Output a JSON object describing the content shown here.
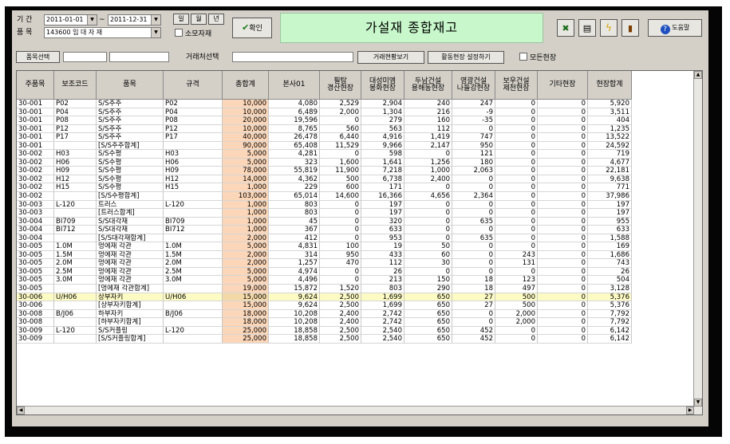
{
  "filters": {
    "period_label": "기 간",
    "date_from": "2011-01-01",
    "tilde": "~",
    "date_to": "2011-12-31",
    "period_buttons": [
      "일",
      "월",
      "년"
    ],
    "category_label": "품 목",
    "category_value": "143600 임 대 자 재",
    "consumable_check_label": "소모자재",
    "confirm_label": "확인",
    "item_select_label": "품목선택",
    "client_select_label": "거래처선택",
    "client_status_button": "거래현황보기",
    "active_site_button": "활동현장 설정하기",
    "all_sites_check_label": "모든현장"
  },
  "title": "가설재 종합재고",
  "help_label": "도움말",
  "icons": [
    "excel-icon",
    "print-icon",
    "lightning-icon",
    "exit-icon",
    "help-icon"
  ],
  "colors": {
    "total_column": "#fbd6b8",
    "selected_row": "#fdfbc4",
    "title_bg": "#c7f7ca"
  },
  "table": {
    "columns": [
      "주품목",
      "보조코드",
      "품목",
      "규격",
      "총합계",
      "본사01",
      "필탐\n경산현장",
      "대성미엠\n봉화현장",
      "두남건설\n용해동현장",
      "영광건설\n나들강현장",
      "보우건설\n제천현장",
      "기타현장",
      "현장합계"
    ],
    "selected_row_index": 41,
    "rows": [
      [
        "30-001",
        "P02",
        "S/S주주",
        "P02",
        "10,000",
        "4,080",
        "2,529",
        "2,904",
        "240",
        "247",
        "0",
        "0",
        "5,920"
      ],
      [
        "30-001",
        "P04",
        "S/S주주",
        "P04",
        "10,000",
        "6,489",
        "2,000",
        "1,304",
        "216",
        "-9",
        "0",
        "0",
        "3,511"
      ],
      [
        "30-001",
        "P08",
        "S/S주주",
        "P08",
        "20,000",
        "19,596",
        "0",
        "279",
        "160",
        "-35",
        "0",
        "0",
        "404"
      ],
      [
        "30-001",
        "P12",
        "S/S주주",
        "P12",
        "10,000",
        "8,765",
        "560",
        "563",
        "112",
        "0",
        "0",
        "0",
        "1,235"
      ],
      [
        "30-001",
        "P17",
        "S/S주주",
        "P17",
        "40,000",
        "26,478",
        "6,440",
        "4,916",
        "1,419",
        "747",
        "0",
        "0",
        "13,522"
      ],
      [
        "30-001",
        "",
        "[S/S주주합계]",
        "",
        "90,000",
        "65,408",
        "11,529",
        "9,966",
        "2,147",
        "950",
        "0",
        "0",
        "24,592"
      ],
      [
        "30-002",
        "H03",
        "S/S수평",
        "H03",
        "5,000",
        "4,281",
        "0",
        "598",
        "0",
        "121",
        "0",
        "0",
        "719"
      ],
      [
        "30-002",
        "H06",
        "S/S수평",
        "H06",
        "5,000",
        "323",
        "1,600",
        "1,641",
        "1,256",
        "180",
        "0",
        "0",
        "4,677"
      ],
      [
        "30-002",
        "H09",
        "S/S수평",
        "H09",
        "78,000",
        "55,819",
        "11,900",
        "7,218",
        "1,000",
        "2,063",
        "0",
        "0",
        "22,181"
      ],
      [
        "30-002",
        "H12",
        "S/S수평",
        "H12",
        "14,000",
        "4,362",
        "500",
        "6,738",
        "2,400",
        "0",
        "0",
        "0",
        "9,638"
      ],
      [
        "30-002",
        "H15",
        "S/S수평",
        "H15",
        "1,000",
        "229",
        "600",
        "171",
        "0",
        "0",
        "0",
        "0",
        "771"
      ],
      [
        "30-002",
        "",
        "[S/S수평합계]",
        "",
        "103,000",
        "65,014",
        "14,600",
        "16,366",
        "4,656",
        "2,364",
        "0",
        "0",
        "37,986"
      ],
      [
        "30-003",
        "L-120",
        "트러스",
        "L-120",
        "1,000",
        "803",
        "0",
        "197",
        "0",
        "0",
        "0",
        "0",
        "197"
      ],
      [
        "30-003",
        "",
        "[트러스합계]",
        "",
        "1,000",
        "803",
        "0",
        "197",
        "0",
        "0",
        "0",
        "0",
        "197"
      ],
      [
        "30-004",
        "BI709",
        "S/S대각재",
        "BI709",
        "1,000",
        "45",
        "0",
        "320",
        "0",
        "635",
        "0",
        "0",
        "955"
      ],
      [
        "30-004",
        "BI712",
        "S/S대각재",
        "BI712",
        "1,000",
        "367",
        "0",
        "633",
        "0",
        "0",
        "0",
        "0",
        "633"
      ],
      [
        "30-004",
        "",
        "[S/S대각재합계]",
        "",
        "2,000",
        "412",
        "0",
        "953",
        "0",
        "635",
        "0",
        "0",
        "1,588"
      ],
      [
        "30-005",
        "1.0M",
        "멍에재 각관",
        "1.0M",
        "5,000",
        "4,831",
        "100",
        "19",
        "50",
        "0",
        "0",
        "0",
        "169"
      ],
      [
        "30-005",
        "1.5M",
        "멍에재 각관",
        "1.5M",
        "2,000",
        "314",
        "950",
        "433",
        "60",
        "0",
        "243",
        "0",
        "1,686"
      ],
      [
        "30-005",
        "2.0M",
        "멍에재 각관",
        "2.0M",
        "2,000",
        "1,257",
        "470",
        "112",
        "30",
        "0",
        "131",
        "0",
        "743"
      ],
      [
        "30-005",
        "2.5M",
        "멍에재 각관",
        "2.5M",
        "5,000",
        "4,974",
        "0",
        "26",
        "0",
        "0",
        "0",
        "0",
        "26"
      ],
      [
        "30-005",
        "3.0M",
        "멍에재 각관",
        "3.0M",
        "5,000",
        "4,496",
        "0",
        "213",
        "150",
        "18",
        "123",
        "0",
        "504"
      ],
      [
        "30-005",
        "",
        "[멍에재 각관합계]",
        "",
        "19,000",
        "15,872",
        "1,520",
        "803",
        "290",
        "18",
        "497",
        "0",
        "3,128"
      ],
      [
        "30-006",
        "U/H06",
        "상부자키",
        "U/H06",
        "15,000",
        "9,624",
        "2,500",
        "1,699",
        "650",
        "27",
        "500",
        "0",
        "5,376"
      ],
      [
        "30-006",
        "",
        "[상부자키합계]",
        "",
        "15,000",
        "9,624",
        "2,500",
        "1,699",
        "650",
        "27",
        "500",
        "0",
        "5,376"
      ],
      [
        "30-008",
        "B/J06",
        "하부자키",
        "B/J06",
        "18,000",
        "10,208",
        "2,400",
        "2,742",
        "650",
        "0",
        "2,000",
        "0",
        "7,792"
      ],
      [
        "30-008",
        "",
        "[하부자키합계]",
        "",
        "18,000",
        "10,208",
        "2,400",
        "2,742",
        "650",
        "0",
        "2,000",
        "0",
        "7,792"
      ],
      [
        "30-009",
        "L-120",
        "S/S커플링",
        "L-120",
        "25,000",
        "18,858",
        "2,500",
        "2,540",
        "650",
        "452",
        "0",
        "0",
        "6,142"
      ],
      [
        "30-009",
        "",
        "[S/S커플링합계]",
        "",
        "25,000",
        "18,858",
        "2,500",
        "2,540",
        "650",
        "452",
        "0",
        "0",
        "6,142"
      ]
    ]
  }
}
